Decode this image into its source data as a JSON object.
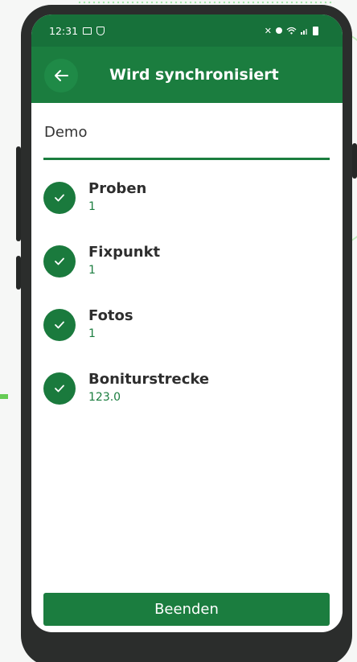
{
  "status_bar": {
    "time": "12:31",
    "left_icons": [
      "image-icon",
      "shield-icon"
    ],
    "right_icons": [
      "mute-icon",
      "location-icon",
      "wifi-icon",
      "signal-icon",
      "battery-icon"
    ]
  },
  "app_bar": {
    "back_icon": "arrow-left-icon",
    "title": "Wird synchronisiert"
  },
  "project": {
    "name": "Demo"
  },
  "sync_items": [
    {
      "label": "Proben",
      "value": "1",
      "status_icon": "check-icon"
    },
    {
      "label": "Fixpunkt",
      "value": "1",
      "status_icon": "check-icon"
    },
    {
      "label": "Fotos",
      "value": "1",
      "status_icon": "check-icon"
    },
    {
      "label": "Boniturstrecke",
      "value": "123.0",
      "status_icon": "check-icon"
    }
  ],
  "footer": {
    "finish_label": "Beenden"
  },
  "colors": {
    "primary": "#1b7d3f",
    "status_bar": "#17713a",
    "text": "#2e2e2e"
  }
}
